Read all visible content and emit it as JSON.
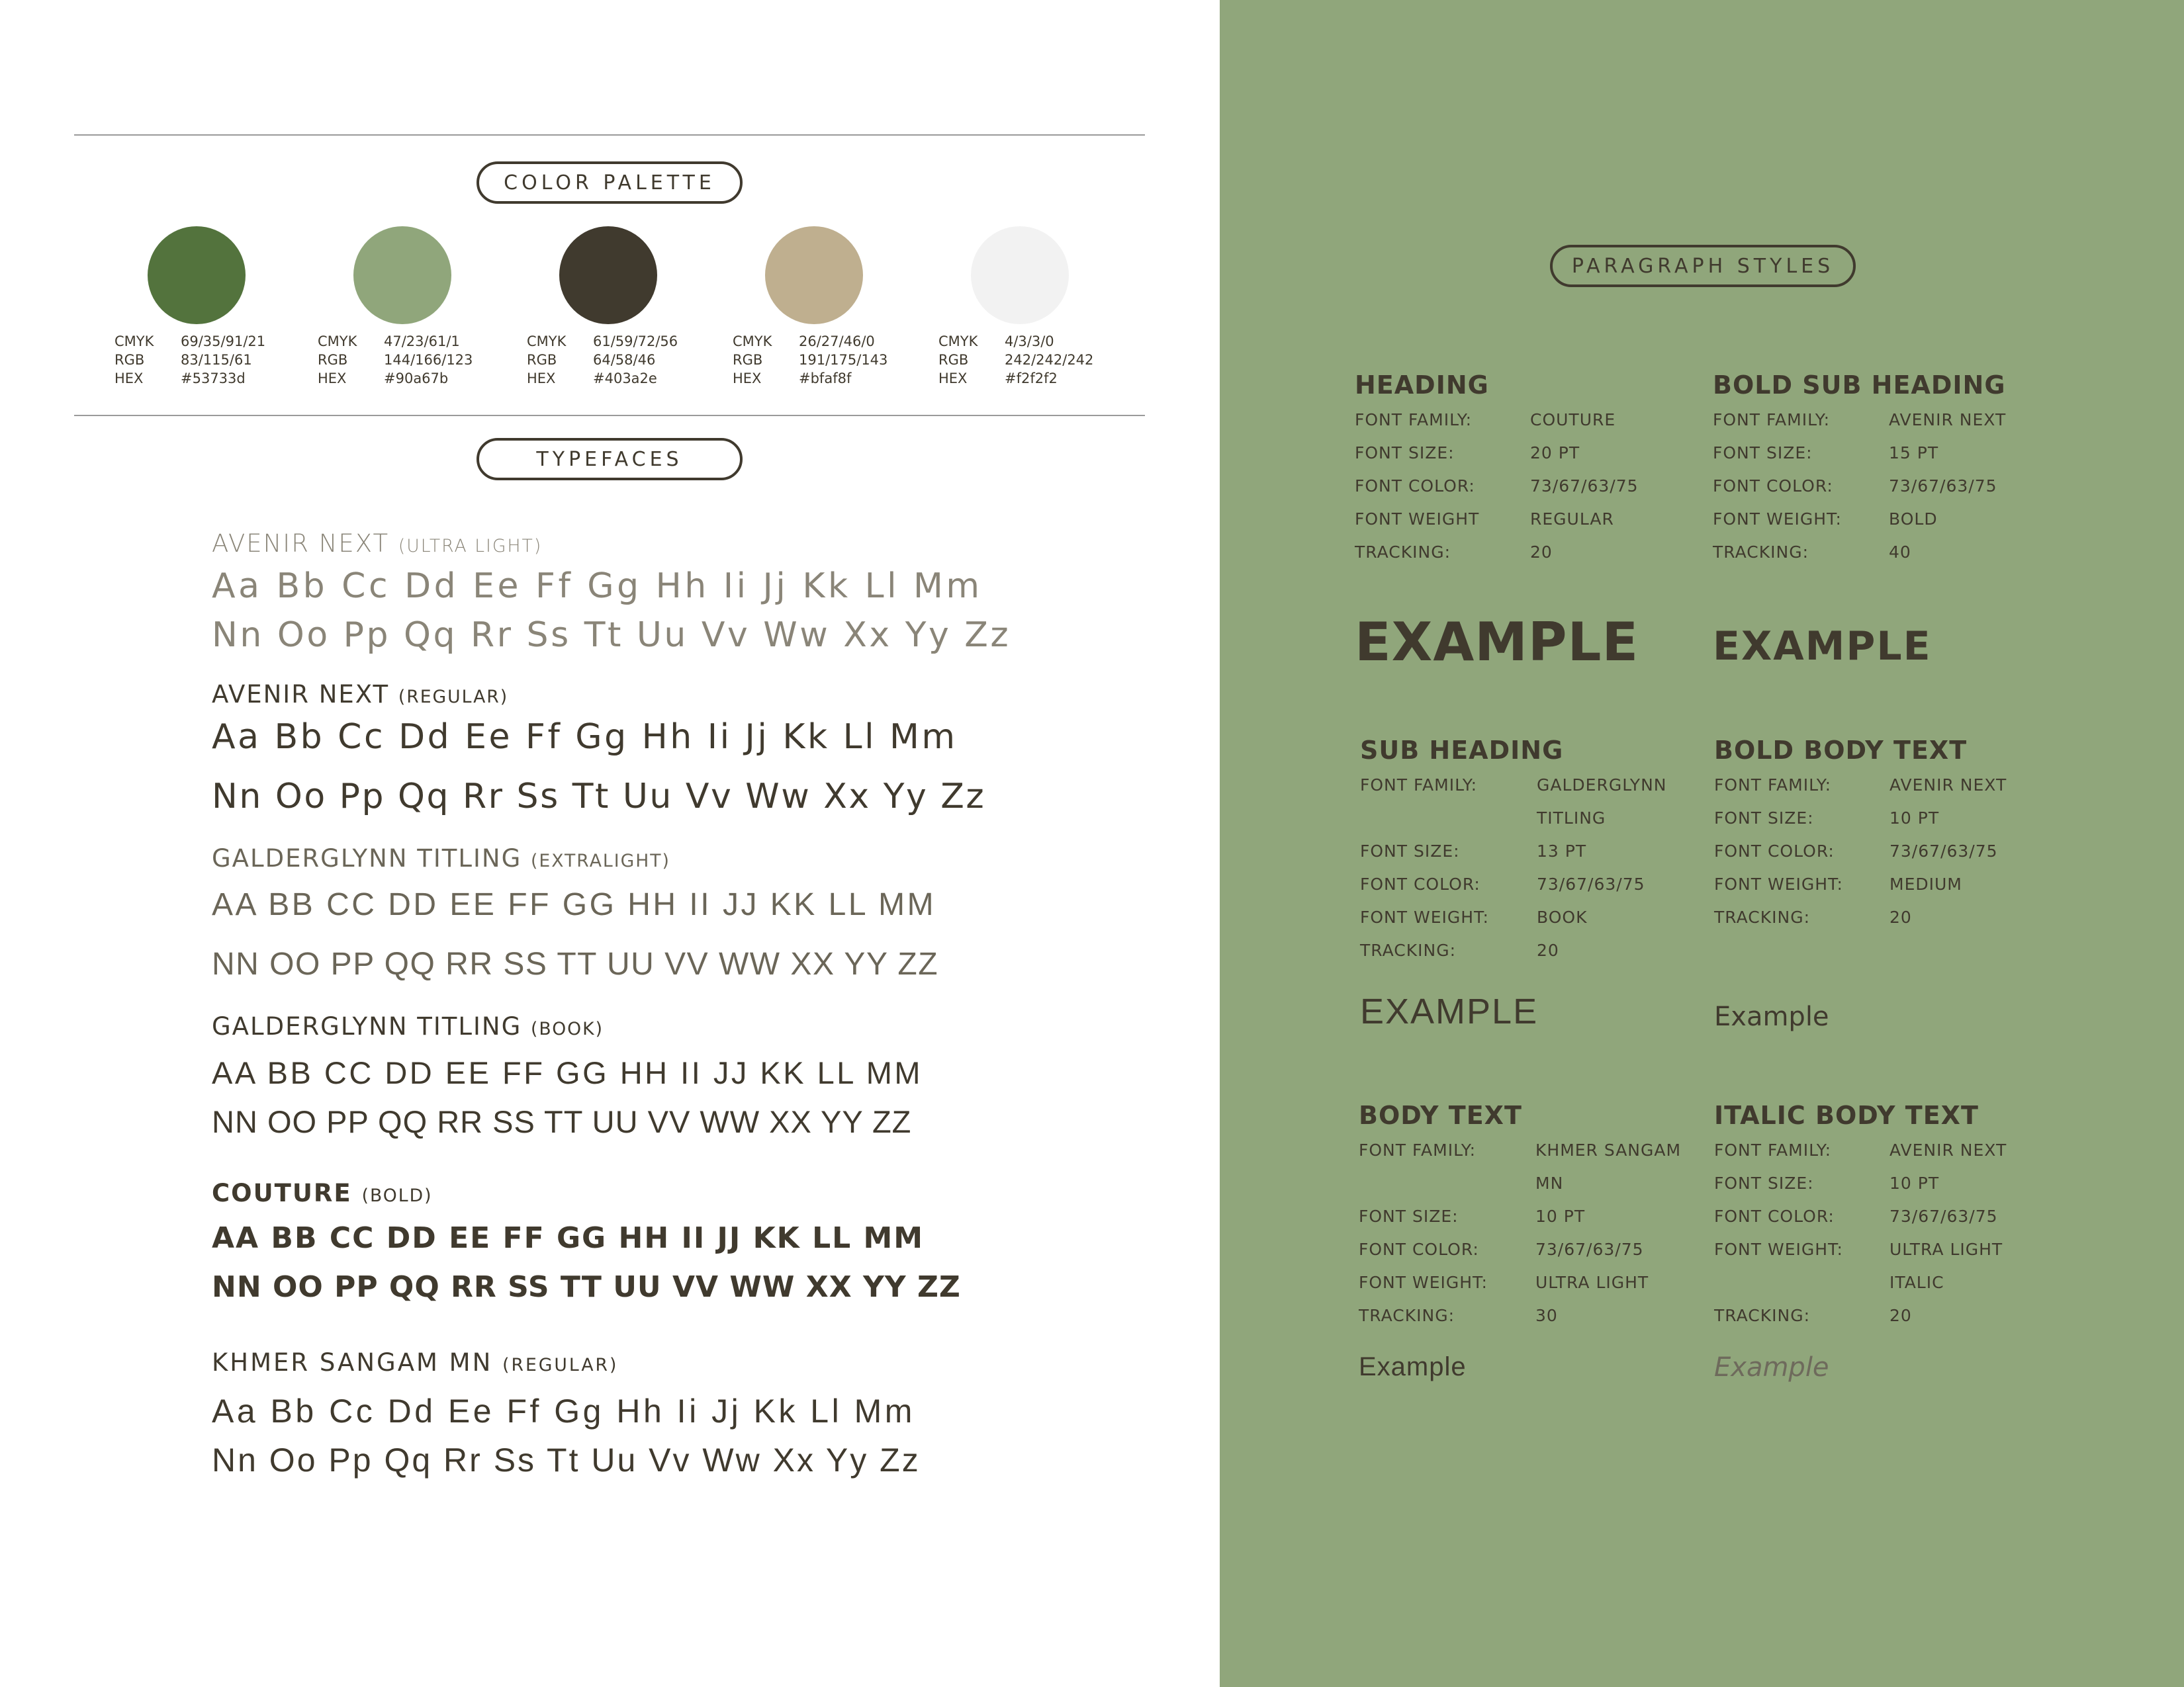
{
  "color_palette": {
    "label": "COLOR PALETTE",
    "swatches": [
      {
        "color": "#53733d",
        "cmyk_label": "CMYK",
        "cmyk": "69/35/91/21",
        "rgb_label": "RGB",
        "rgb": "83/115/61",
        "hex_label": "HEX",
        "hex": "#53733d"
      },
      {
        "color": "#90a67b",
        "cmyk_label": "CMYK",
        "cmyk": "47/23/61/1",
        "rgb_label": "RGB",
        "rgb": "144/166/123",
        "hex_label": "HEX",
        "hex": "#90a67b"
      },
      {
        "color": "#403a2e",
        "cmyk_label": "CMYK",
        "cmyk": "61/59/72/56",
        "rgb_label": "RGB",
        "rgb": "64/58/46",
        "hex_label": "HEX",
        "hex": "#403a2e"
      },
      {
        "color": "#bfaf8f",
        "cmyk_label": "CMYK",
        "cmyk": "26/27/46/0",
        "rgb_label": "RGB",
        "rgb": "191/175/143",
        "hex_label": "HEX",
        "hex": "#bfaf8f"
      },
      {
        "color": "#f2f2f2",
        "cmyk_label": "CMYK",
        "cmyk": "4/3/3/0",
        "rgb_label": "RGB",
        "rgb": "242/242/242",
        "hex_label": "HEX",
        "hex": "#f2f2f2"
      }
    ]
  },
  "typefaces": {
    "label": "TYPEFACES",
    "items": [
      {
        "name": "AVENIR NEXT",
        "style": "(ULTRA LIGHT)",
        "line1": "Aa Bb Cc Dd Ee Ff Gg Hh Ii Jj Kk Ll Mm",
        "line2": "Nn Oo Pp Qq Rr Ss Tt Uu Vv Ww Xx Yy Zz"
      },
      {
        "name": "AVENIR NEXT",
        "style": "(REGULAR)",
        "line1": "Aa Bb Cc Dd Ee Ff Gg Hh Ii Jj Kk Ll Mm",
        "line2": "Nn Oo Pp Qq Rr Ss Tt Uu Vv Ww Xx Yy Zz"
      },
      {
        "name": "GALDERGLYNN TITLING",
        "style": "(EXTRALIGHT)",
        "line1": "AA BB CC DD EE FF GG HH II JJ KK LL MM",
        "line2": "NN OO PP QQ RR SS TT UU VV WW XX YY ZZ"
      },
      {
        "name": "GALDERGLYNN TITLING",
        "style": "(BOOK)",
        "line1": "AA BB CC DD EE FF GG HH II JJ KK LL MM",
        "line2": "NN OO PP QQ RR SS TT UU VV WW XX YY ZZ"
      },
      {
        "name": "COUTURE",
        "style": "(BOLD)",
        "line1": "AA BB CC DD EE FF GG HH II JJ KK LL MM",
        "line2": "NN OO PP QQ RR SS TT UU VV WW XX YY ZZ"
      },
      {
        "name": "KHMER SANGAM MN",
        "style": "(REGULAR)",
        "line1": "Aa Bb Cc Dd Ee Ff Gg Hh Ii Jj Kk Ll Mm",
        "line2": "Nn Oo Pp Qq Rr Ss Tt Uu Vv Ww Xx Yy Zz"
      }
    ]
  },
  "paragraph_styles": {
    "label": "PARAGRAPH STYLES",
    "styles": [
      {
        "title": "HEADING",
        "example": "EXAMPLE",
        "rows": [
          [
            "FONT FAMILY:",
            "COUTURE"
          ],
          [
            "FONT SIZE:",
            "20 PT"
          ],
          [
            "FONT COLOR:",
            "73/67/63/75"
          ],
          [
            "FONT WEIGHT",
            "REGULAR"
          ],
          [
            "TRACKING:",
            "20"
          ]
        ]
      },
      {
        "title": "BOLD SUB HEADING",
        "example": "EXAMPLE",
        "rows": [
          [
            "FONT FAMILY:",
            "AVENIR NEXT"
          ],
          [
            "FONT SIZE:",
            "15 PT"
          ],
          [
            "FONT COLOR:",
            "73/67/63/75"
          ],
          [
            "FONT WEIGHT:",
            "BOLD"
          ],
          [
            "TRACKING:",
            "40"
          ]
        ]
      },
      {
        "title": "SUB HEADING",
        "example": "EXAMPLE",
        "rows": [
          [
            "FONT FAMILY:",
            "GALDERGLYNN"
          ],
          [
            "",
            "TITLING"
          ],
          [
            "FONT SIZE:",
            "13 PT"
          ],
          [
            "FONT COLOR:",
            "73/67/63/75"
          ],
          [
            "FONT WEIGHT:",
            "BOOK"
          ],
          [
            "TRACKING:",
            "20"
          ]
        ]
      },
      {
        "title": "BOLD BODY TEXT",
        "example": "Example",
        "rows": [
          [
            "FONT FAMILY:",
            "AVENIR NEXT"
          ],
          [
            "FONT SIZE:",
            "10 PT"
          ],
          [
            "FONT COLOR:",
            "73/67/63/75"
          ],
          [
            "FONT WEIGHT:",
            "MEDIUM"
          ],
          [
            "TRACKING:",
            "20"
          ]
        ]
      },
      {
        "title": "BODY TEXT",
        "example": "Example",
        "rows": [
          [
            "FONT FAMILY:",
            "KHMER SANGAM"
          ],
          [
            "",
            "MN"
          ],
          [
            "FONT SIZE:",
            "10 PT"
          ],
          [
            "FONT COLOR:",
            "73/67/63/75"
          ],
          [
            "FONT WEIGHT:",
            "ULTRA LIGHT"
          ],
          [
            "TRACKING:",
            "30"
          ]
        ]
      },
      {
        "title": "ITALIC BODY TEXT",
        "example": "Example",
        "rows": [
          [
            "FONT FAMILY:",
            "AVENIR NEXT"
          ],
          [
            "FONT SIZE:",
            "10 PT"
          ],
          [
            "FONT COLOR:",
            "73/67/63/75"
          ],
          [
            "FONT WEIGHT:",
            "ULTRA LIGHT"
          ],
          [
            "",
            "ITALIC"
          ],
          [
            "TRACKING:",
            "20"
          ]
        ]
      }
    ]
  }
}
